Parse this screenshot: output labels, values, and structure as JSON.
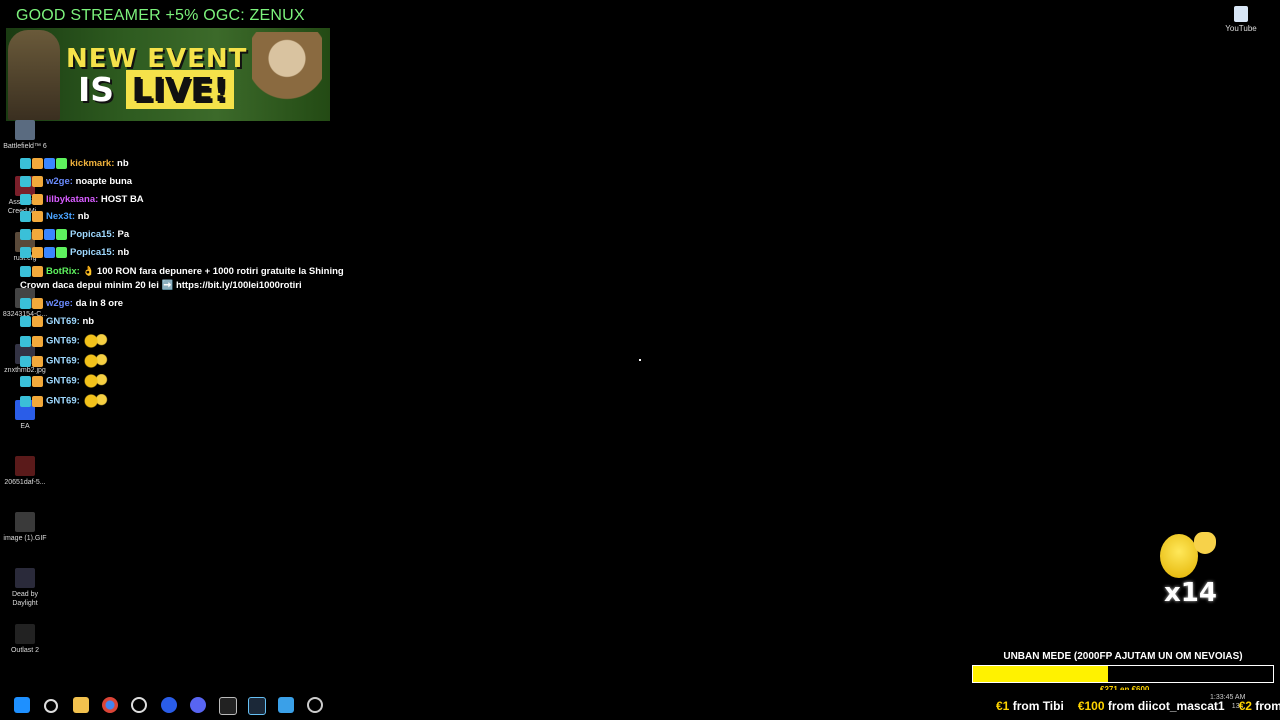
{
  "promo_text": "GOOD STREAMER +5% OGC: ZENUX",
  "event_banner": {
    "line1": "NEW EVENT",
    "line2_prefix": "IS ",
    "line2_live": "LIVE!"
  },
  "desktop_icons": [
    {
      "name": "battlefield-icon",
      "label": "Battlefield™ 6",
      "color": "#5a6b80"
    },
    {
      "name": "assassins-creed-icon",
      "label": "Assassin's Creed Mi...",
      "color": "#7a1f2a"
    },
    {
      "name": "rust-icon",
      "label": "rust.cfg",
      "color": "#5a4a3a"
    },
    {
      "name": "file-icon",
      "label": "83243154-C...",
      "color": "#444444"
    },
    {
      "name": "image-file-icon",
      "label": "znxthmb2.jpg",
      "color": "#333344"
    },
    {
      "name": "ea-icon",
      "label": "EA",
      "color": "#2a5de8"
    },
    {
      "name": "folder-icon",
      "label": "20651daf-5...",
      "color": "#5a1a1a"
    },
    {
      "name": "gif-icon",
      "label": "image (1).GIF",
      "color": "#3a3a3a"
    },
    {
      "name": "dead-by-daylight-icon",
      "label": "Dead by Daylight",
      "color": "#2a2a3a"
    },
    {
      "name": "outlast-icon",
      "label": "Outlast 2",
      "color": "#222222"
    }
  ],
  "youtube_icon": {
    "label": "YouTube"
  },
  "chat": [
    {
      "user": "kickmark",
      "color": "#f0b23c",
      "msg": "nb"
    },
    {
      "user": "w2ge",
      "color": "#6b8cff",
      "msg": "noapte buna"
    },
    {
      "user": "lilbykatana",
      "color": "#d75cff",
      "msg": "HOST BA"
    },
    {
      "user": "Nex3t",
      "color": "#4aa3ff",
      "msg": "nb"
    },
    {
      "user": "Popica15",
      "color": "#9fd9ff",
      "msg": "Pa"
    },
    {
      "user": "Popica15",
      "color": "#9fd9ff",
      "msg": "nb"
    },
    {
      "user": "BotRix",
      "color": "#5ef25e",
      "msg": "👌 100 RON fara depunere + 1000 rotiri gratuite la Shining",
      "msg2": "Crown daca depui minim 20 lei ➡️ https://bit.ly/100lei1000rotiri"
    },
    {
      "user": "w2ge",
      "color": "#6b8cff",
      "msg": "da in 8 ore"
    },
    {
      "user": "GNT69",
      "color": "#9fd9ff",
      "msg": "nb"
    },
    {
      "user": "GNT69",
      "color": "#9fd9ff",
      "msg": ""
    },
    {
      "user": "GNT69",
      "color": "#9fd9ff",
      "msg": ""
    },
    {
      "user": "GNT69",
      "color": "#9fd9ff",
      "msg": ""
    },
    {
      "user": "GNT69",
      "color": "#9fd9ff",
      "msg": ""
    }
  ],
  "combo": {
    "count": "x14"
  },
  "goal": {
    "title": "UNBAN MEDE (2000FP AJUTAM UN OM NEVOIAS)",
    "percent_label": "45%",
    "progress": 0.45,
    "sub": "€271 en €600"
  },
  "ticker": [
    {
      "amount": "€1",
      "text": " from Tibi"
    },
    {
      "amount": "€100",
      "text": " from diicot_mascat1"
    },
    {
      "amount": "€2",
      "text": " from Elv"
    }
  ],
  "tray": {
    "time": "1:33:45 AM",
    "date": "13..."
  }
}
